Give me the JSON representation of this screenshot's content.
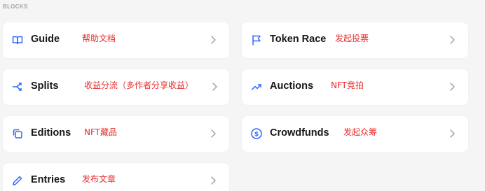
{
  "section_label": "BLOCKS",
  "cards": {
    "guide": {
      "title": "Guide",
      "note": "帮助文档",
      "icon": "book-icon"
    },
    "token_race": {
      "title": "Token Race",
      "note": "发起投票",
      "icon": "flag-icon"
    },
    "splits": {
      "title": "Splits",
      "note": "收益分流（多作者分享收益）",
      "icon": "split-arrow-icon"
    },
    "auctions": {
      "title": "Auctions",
      "note": "NFT竞拍",
      "icon": "trend-up-icon"
    },
    "editions": {
      "title": "Editions",
      "note": "NFT藏品",
      "icon": "copy-icon"
    },
    "crowdfunds": {
      "title": "Crowdfunds",
      "note": "发起众筹",
      "icon": "dollar-coin-icon"
    },
    "entries": {
      "title": "Entries",
      "note": "发布文章",
      "icon": "pencil-icon"
    }
  },
  "colors": {
    "accent": "#2f66ff",
    "note": "#e5302e",
    "title": "#15161a",
    "background": "#f5f5f6",
    "card": "#ffffff"
  }
}
